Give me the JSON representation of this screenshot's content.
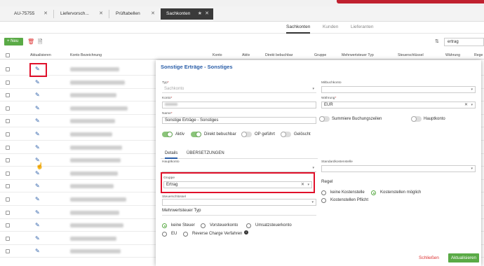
{
  "tabs": [
    {
      "label": "AU-75755"
    },
    {
      "label": "Liefervorsch..."
    },
    {
      "label": "Prüftabellen"
    },
    {
      "label": "Sachkonten"
    }
  ],
  "subtabs": [
    "Sachkonten",
    "Kunden",
    "Lieferanten"
  ],
  "toolbar": {
    "new_label": "Neu",
    "search_value": "ertrag"
  },
  "table": {
    "headers": [
      "Aktualisieren",
      "Konto Bezeichnung",
      "Konto",
      "Aktiv",
      "Direkt bebuchbar",
      "Gruppe",
      "Mehrwertsteuer Typ",
      "Steuerschlüssel",
      "Währung",
      "Rege"
    ]
  },
  "modal": {
    "title": "Sonstige Erträge - Sonstiges",
    "typ_label": "Typ",
    "typ_value": "Sachkonto",
    "mitbuch_label": "Mitbuchkonto",
    "konto_label": "Konto",
    "waehrung_label": "Währung",
    "waehrung_value": "EUR",
    "name_label": "Name",
    "name_value": "Sonstige Erträge - Sonstiges",
    "toggles": {
      "summiere": "Summiere Buchungszeilen",
      "hauptkonto": "Hauptkonto",
      "aktiv": "Aktiv",
      "direkt": "Direkt bebuchbar",
      "op": "OP geführt",
      "geloescht": "Gelöscht"
    },
    "detail_tabs": [
      "Details",
      "ÜBERSETZUNGEN"
    ],
    "hauptkonto_label": "Hauptkonto",
    "standardkostenstelle_label": "Standardkostenstelle",
    "gruppe_label": "Gruppe",
    "gruppe_value": "Ertrag",
    "steuerschluessel_label": "Steuerschlüssel",
    "regel_title": "Regel",
    "regel_options": [
      "keine Kostenstelle",
      "Kostenstellen möglich",
      "Kostenstellen Pflicht"
    ],
    "mwst_title": "Mehrwertsteuer Typ",
    "mwst_options": [
      "keine Steuer",
      "Vorsteuerkonto",
      "Umsatzsteuerkonto",
      "EU",
      "Reverse Charge Verfahren"
    ],
    "close_label": "Schließen",
    "update_label": "Aktualisieren"
  },
  "colors": {
    "accent": "#2a5ea8",
    "primary_button": "#5aaa46",
    "danger": "#e0102a"
  }
}
